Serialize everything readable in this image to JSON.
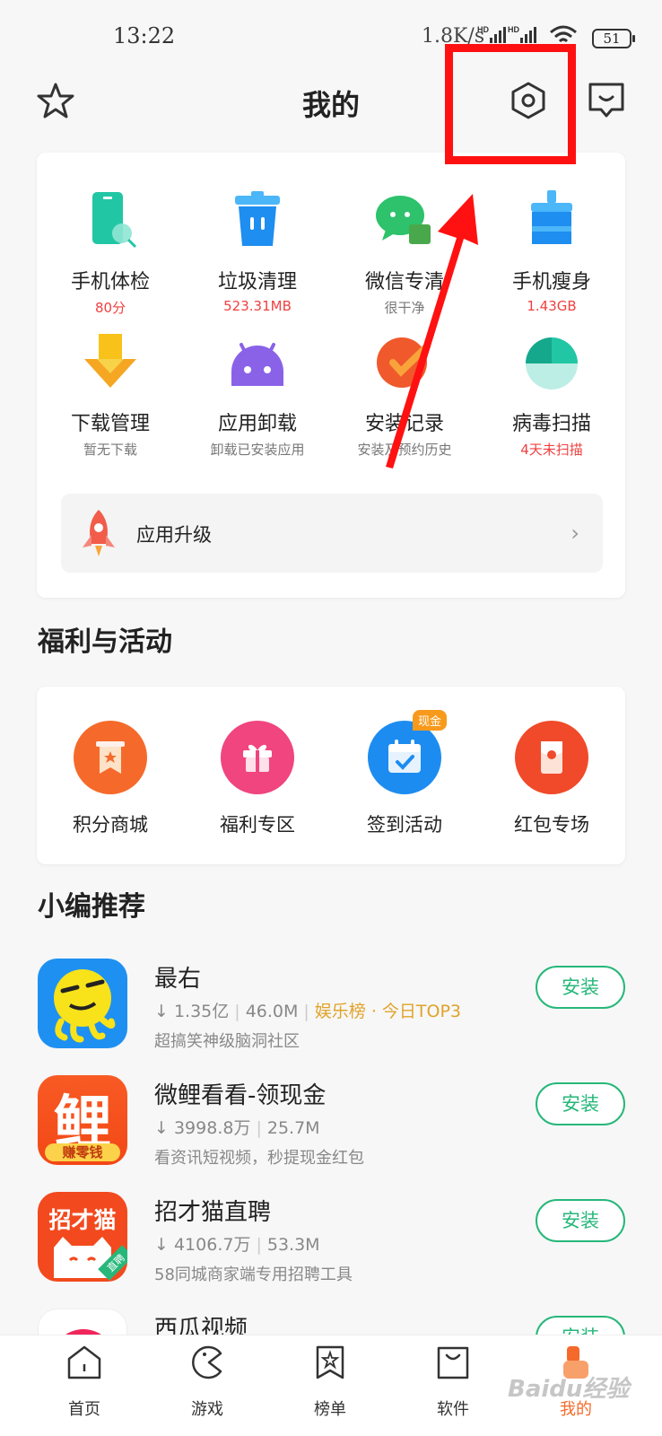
{
  "status_bar": {
    "time": "13:22",
    "speed": "1.8K/s",
    "hd1": "HD",
    "hd2": "HD",
    "battery": "51"
  },
  "header": {
    "title": "我的",
    "left_icon": "star-icon",
    "settings_icon": "settings-icon",
    "right_icon": "message-icon"
  },
  "tools": [
    {
      "name": "手机体检",
      "sub": "80分",
      "sub_color": "red",
      "icon": "phone-check-icon"
    },
    {
      "name": "垃圾清理",
      "sub": "523.31MB",
      "sub_color": "red",
      "icon": "trash-icon"
    },
    {
      "name": "微信专清",
      "sub": "很干净",
      "sub_color": "gray",
      "icon": "wechat-clean-icon"
    },
    {
      "name": "手机瘦身",
      "sub": "1.43GB",
      "sub_color": "red",
      "icon": "slim-brush-icon"
    },
    {
      "name": "下载管理",
      "sub": "暂无下载",
      "sub_color": "gray",
      "icon": "download-icon"
    },
    {
      "name": "应用卸载",
      "sub": "卸载已安装应用",
      "sub_color": "gray",
      "icon": "uninstall-android-icon"
    },
    {
      "name": "安装记录",
      "sub": "安装及预约历史",
      "sub_color": "gray",
      "icon": "install-record-icon"
    },
    {
      "name": "病毒扫描",
      "sub": "4天未扫描",
      "sub_color": "red",
      "icon": "virus-scan-icon"
    }
  ],
  "upgrade": {
    "label": "应用升级",
    "chevron": "›",
    "icon": "rocket-icon"
  },
  "perks_section": {
    "title": "福利与活动",
    "items": [
      {
        "name": "积分商城",
        "icon": "points-mall-icon",
        "color": "#f56a2a"
      },
      {
        "name": "福利专区",
        "icon": "gift-icon",
        "color": "#f0457e"
      },
      {
        "name": "签到活动",
        "icon": "calendar-check-icon",
        "color": "#1d8cf0",
        "badge": "现金"
      },
      {
        "name": "红包专场",
        "icon": "red-envelope-icon",
        "color": "#f04a2a"
      }
    ]
  },
  "recommend_section": {
    "title": "小编推荐",
    "apps": [
      {
        "name": "最右",
        "downloads": "1.35亿",
        "size": "46.0M",
        "tag": "娱乐榜 · 今日TOP3",
        "desc": "超搞笑神级脑洞社区",
        "install": "安装"
      },
      {
        "name": "微鲤看看-领现金",
        "downloads": "3998.8万",
        "size": "25.7M",
        "tag": "",
        "desc": "看资讯短视频，秒提现金红包",
        "install": "安装",
        "icon_text": "鲤",
        "icon_badge": "赚零钱"
      },
      {
        "name": "招才猫直聘",
        "downloads": "4106.7万",
        "size": "53.3M",
        "tag": "",
        "desc": "58同城商家端专用招聘工具",
        "install": "安装",
        "icon_text": "招才猫",
        "icon_badge": "直聘"
      },
      {
        "name": "西瓜视频",
        "install": "安装"
      }
    ]
  },
  "tabbar": [
    {
      "label": "首页",
      "icon": "home-icon"
    },
    {
      "label": "游戏",
      "icon": "game-icon"
    },
    {
      "label": "榜单",
      "icon": "ranking-icon"
    },
    {
      "label": "软件",
      "icon": "software-bag-icon"
    },
    {
      "label": "我的",
      "icon": "mine-icon",
      "active": true
    }
  ],
  "watermark": "Baidu经验",
  "colors": {
    "accent_green": "#27b77a",
    "highlight_red": "#ff1111",
    "warn_red": "#f04040",
    "tag_gold": "#e0a32a"
  }
}
